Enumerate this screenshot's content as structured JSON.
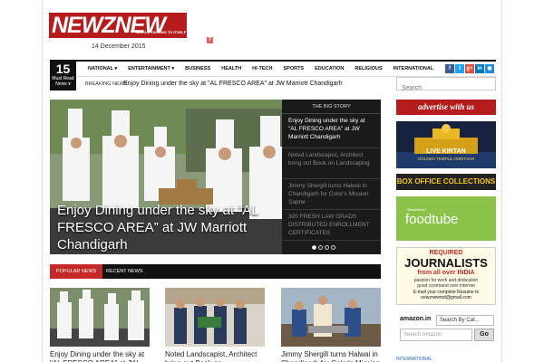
{
  "header": {
    "logo_text": "NEWZNEW",
    "logo_tagline": "WORLD TALKING TO ITSELF",
    "date": "14 December 2015",
    "ad_badge": "?"
  },
  "must_read": {
    "count": "15",
    "label": "Must Read News ▾"
  },
  "nav": {
    "items": [
      "NATIONAL ▾",
      "ENTERTAINMENT ▾",
      "BUSINESS",
      "HEALTH",
      "HI-TECH",
      "SPORTS",
      "EDUCATION",
      "RELIGIOUS",
      "INTERNATIONAL"
    ],
    "social": [
      {
        "icon": "facebook-icon",
        "glyph": "f",
        "color": "#3b5998"
      },
      {
        "icon": "twitter-icon",
        "glyph": "t",
        "color": "#1da1f2"
      },
      {
        "icon": "google-plus-icon",
        "glyph": "g+",
        "color": "#dd4b39"
      },
      {
        "icon": "linkedin-icon",
        "glyph": "in",
        "color": "#0077b5"
      },
      {
        "icon": "rss-icon",
        "glyph": "◉",
        "color": "#1e88e5"
      }
    ]
  },
  "breaking": {
    "label": "BREAKING NEWS",
    "text": "Enjoy Dining under the sky at \"AL FRESCO AREA\" at JW Marriott Chandigarh"
  },
  "search": {
    "placeholder": "Search"
  },
  "hero": {
    "title": "Enjoy Dining under the sky at “AL FRESCO AREA” at JW Marriott Chandigarh"
  },
  "big_story": {
    "heading": "THE BIG STORY",
    "items": [
      "Enjoy Dining under the sky at \"AL FRESCO AREA\" at JW Marriott Chandigarh",
      "Noted Landscapist, Architect bring out Book on Landscaping",
      "Jimmy Shergill turns Halwai in Chandigarh for Color's Mission Sapne",
      "320 FRESH LAW GRADS DISTRIBUTED ENROLLMENT CERTIFICATES"
    ]
  },
  "tabs": {
    "popular": "POPULAR NEWS",
    "recent": "RECENT NEWS"
  },
  "cards": [
    {
      "title": "Enjoy Dining under the sky at \"AL FRESCO AREA\" at JW"
    },
    {
      "title": "Noted Landscapist, Architect bring out Book on Landscaping"
    },
    {
      "title": "Jimmy Shergill turns Halwai in Chandigarh for Color's Mission"
    }
  ],
  "sidebar": {
    "advertise": "advertise with us",
    "live_text": "LIVE KIRTAN",
    "live_sub": "GOLDEN TEMPLE AMRITSAR",
    "box_office": "BOX OFFICE COLLECTIONS",
    "foodtube_small": "NewsNewZ",
    "foodtube": "foodtube",
    "required": "REQUIRED",
    "journalists": "JOURNALISTS",
    "from": "from all over INDIA",
    "passion": "passion for work and dedication",
    "command": "good command over internet",
    "email": "E-mail your complete Resume to newznewmd@gmail.com",
    "amazon_logo": "amazon.in",
    "amazon_category": "Search By Cat...",
    "amazon_placeholder": "Search Amazon",
    "amazon_go": "Go",
    "international": "INTERNATIONAL"
  }
}
